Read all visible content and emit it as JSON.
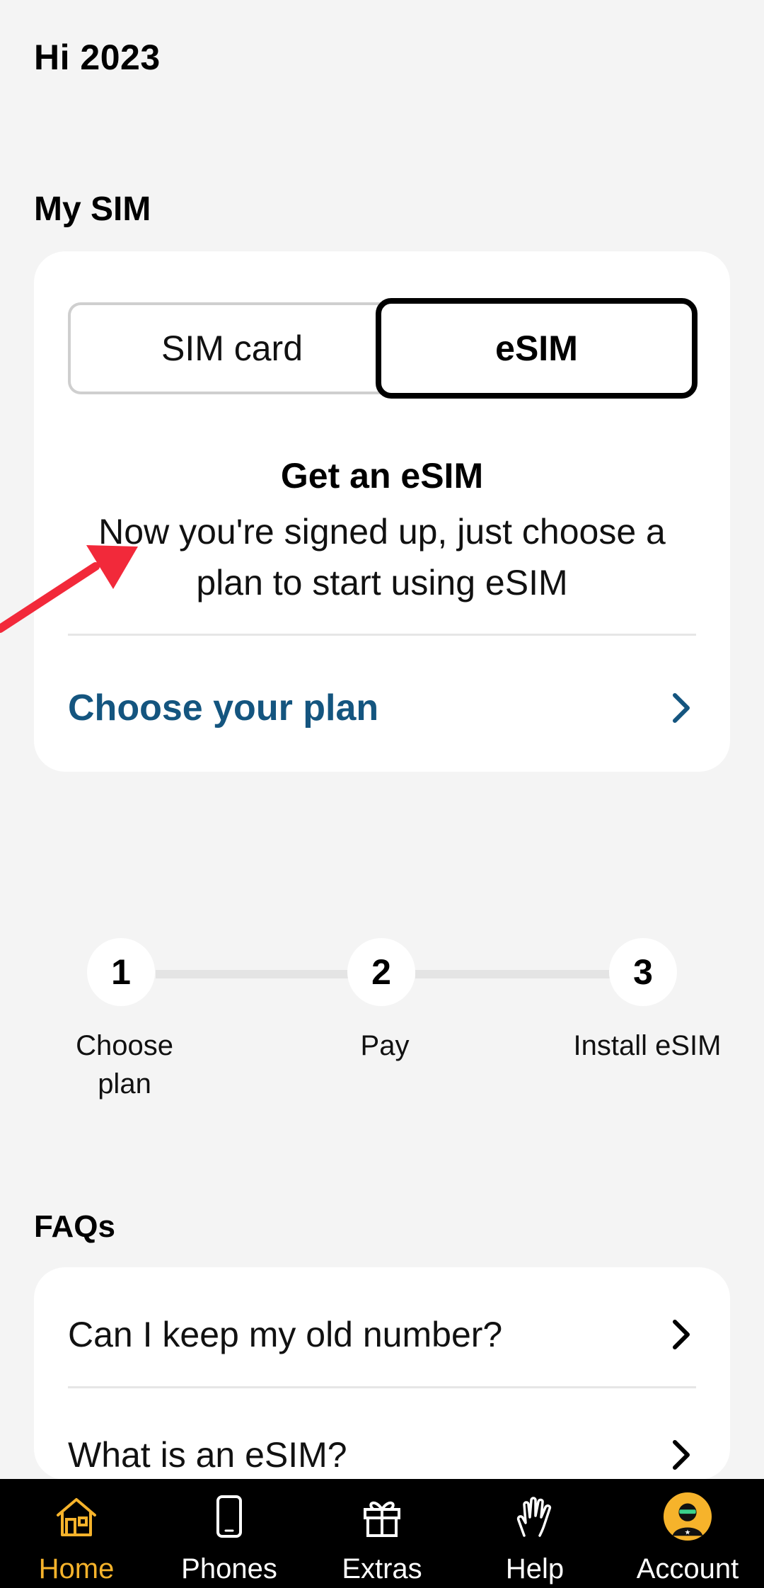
{
  "greeting": "Hi 2023",
  "my_sim": {
    "title": "My SIM",
    "toggle": {
      "left": "SIM card",
      "right": "eSIM",
      "selected": "eSIM"
    },
    "heading": "Get an eSIM",
    "description": "Now you're signed up, just choose a plan to start using eSIM",
    "link": "Choose your plan"
  },
  "steps": [
    {
      "number": "1",
      "label": "Choose plan"
    },
    {
      "number": "2",
      "label": "Pay"
    },
    {
      "number": "3",
      "label": "Install eSIM"
    }
  ],
  "faqs": {
    "title": "FAQs",
    "items": [
      {
        "question": "Can I keep my old number?"
      },
      {
        "question": "What is an eSIM?"
      }
    ]
  },
  "nav": {
    "items": [
      {
        "label": "Home",
        "icon": "home-icon",
        "active": true
      },
      {
        "label": "Phones",
        "icon": "phone-icon",
        "active": false
      },
      {
        "label": "Extras",
        "icon": "gift-icon",
        "active": false
      },
      {
        "label": "Help",
        "icon": "hand-icon",
        "active": false
      },
      {
        "label": "Account",
        "icon": "avatar-icon",
        "active": false
      }
    ]
  },
  "colors": {
    "accent": "#f6b32b",
    "link": "#14557f",
    "annotation_arrow": "#f2293a",
    "background": "#f4f4f4",
    "nav_background": "#000000"
  }
}
